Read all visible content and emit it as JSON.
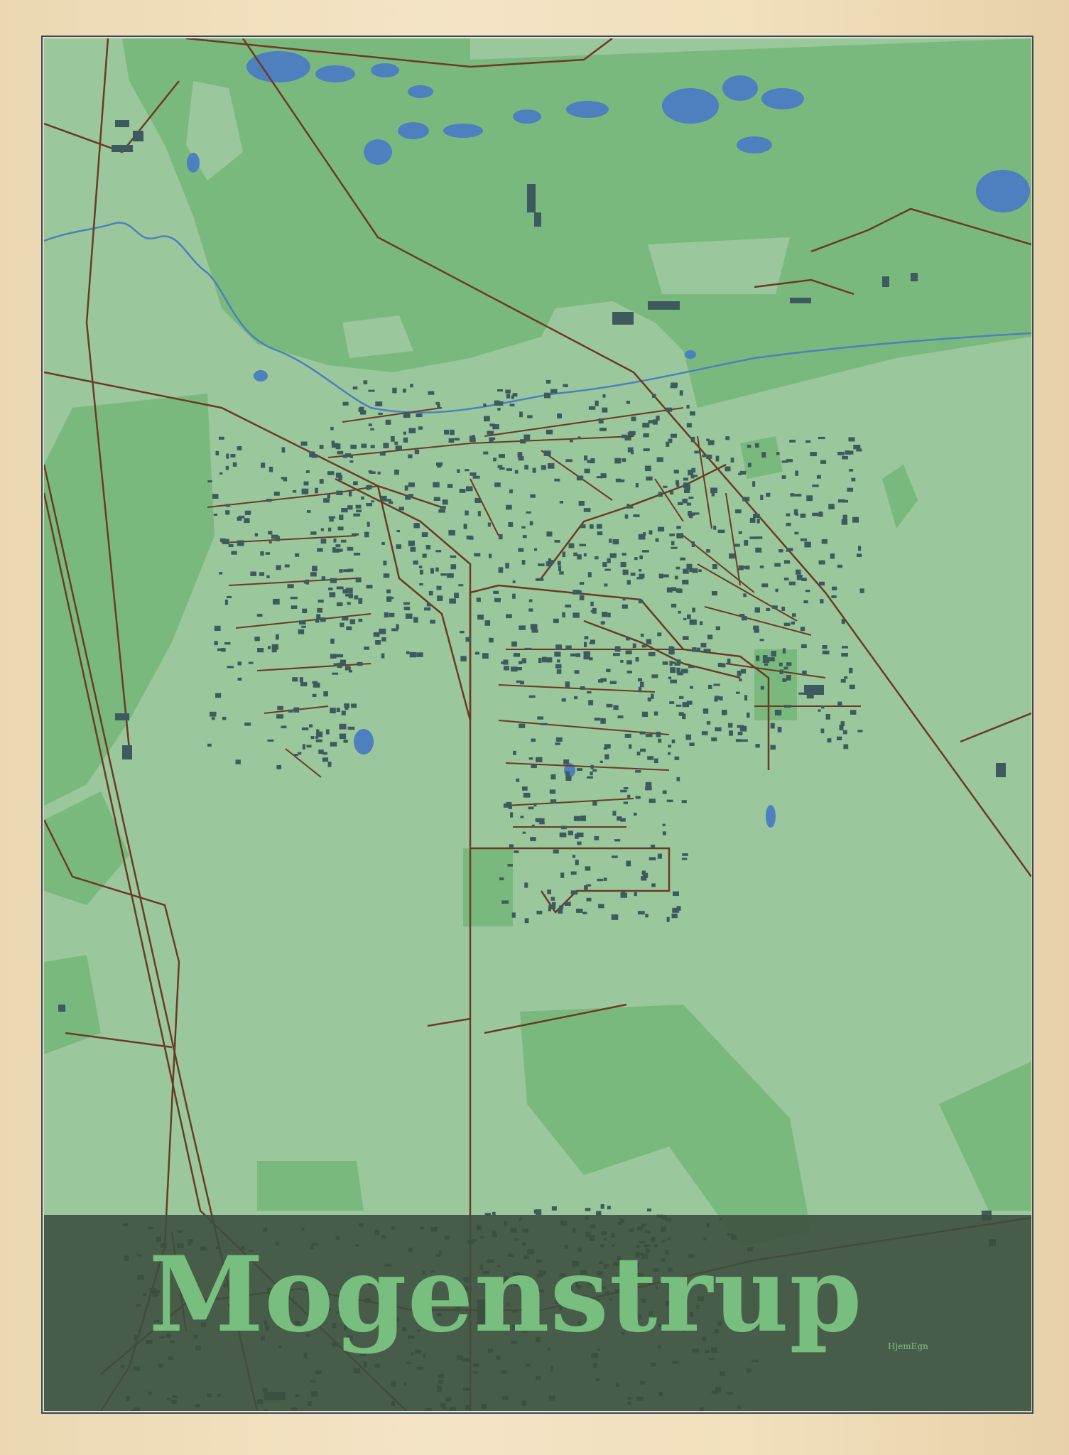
{
  "poster": {
    "title": "Mogenstrup",
    "brand": "HjemEgn"
  },
  "colors": {
    "frame": "#f1dfbd",
    "background": "#9ac79b",
    "forest": "#7ab97d",
    "water": "#4e7fbe",
    "roads": "#6b3a26",
    "buildings": "#3d5a5e",
    "title_band": "#3c4e3e",
    "title_text": "#78bf7f"
  },
  "map": {
    "style": "green",
    "features": [
      "forest",
      "lakes",
      "stream",
      "roads",
      "railway",
      "buildings"
    ]
  }
}
